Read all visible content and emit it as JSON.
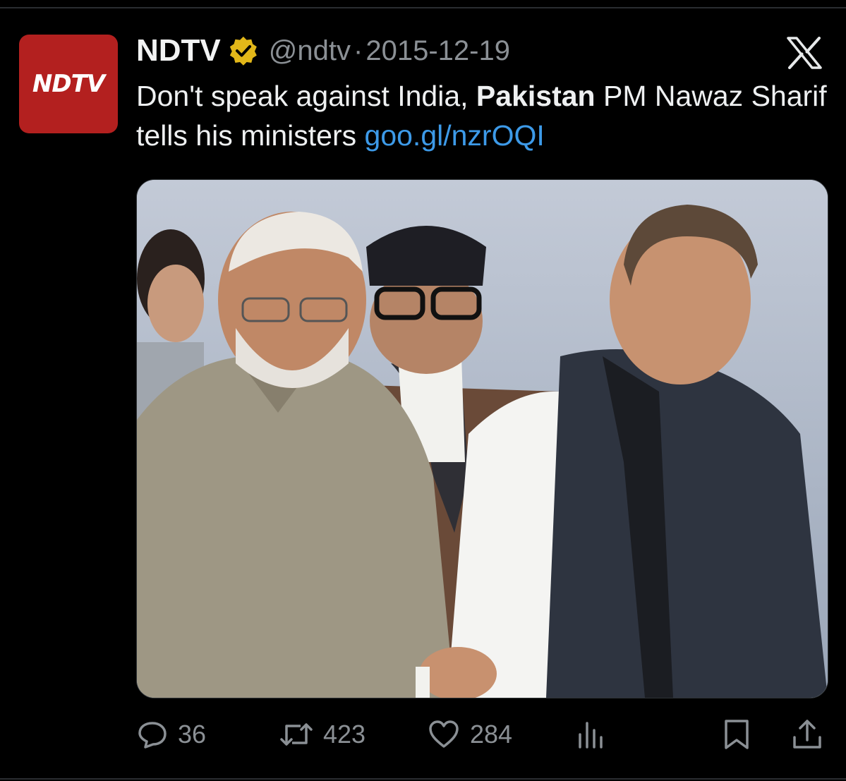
{
  "tweet": {
    "author": {
      "display_name": "NDTV",
      "handle": "@ndtv",
      "verified": true,
      "avatar_text": "NDTV",
      "avatar_color": "#b3201f"
    },
    "separator": "·",
    "timestamp": "2015-12-19",
    "text_parts": {
      "part1": "Don't speak against India, ",
      "bold": "Pakistan",
      "part2": " PM Nawaz Sharif tells his ministers ",
      "link": "goo.gl/nzrOQI"
    },
    "link_color": "#3d9ae8",
    "media": {
      "kind": "photo"
    },
    "metrics": {
      "replies": "36",
      "retweets": "423",
      "likes": "284"
    }
  },
  "icons": {
    "platform_logo": "x-logo-icon",
    "verified": "verified-badge-icon",
    "reply": "reply-icon",
    "retweet": "retweet-icon",
    "like": "heart-icon",
    "views": "views-chart-icon",
    "bookmark": "bookmark-icon",
    "share": "share-icon"
  },
  "colors": {
    "background": "#000000",
    "text": "#e7e9ea",
    "muted": "#8b9095",
    "verified_gold": "#e2b719"
  }
}
